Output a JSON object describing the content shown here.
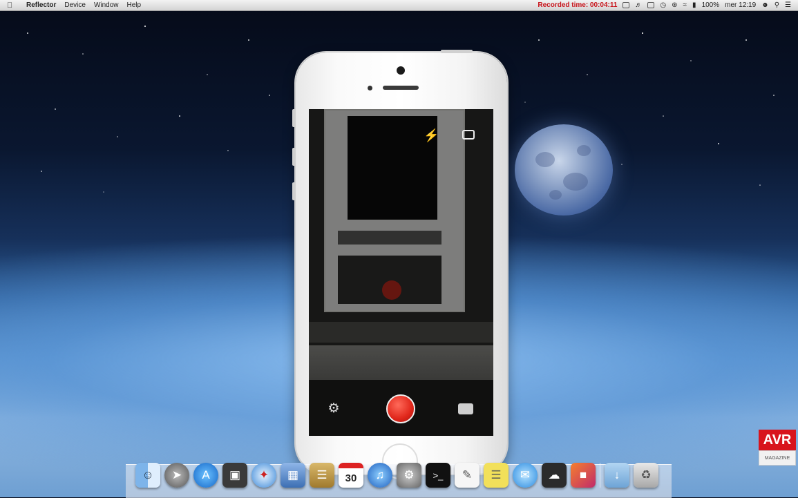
{
  "menubar": {
    "apple_icon": "apple-icon",
    "app_name": "Reflector",
    "menus": [
      "Device",
      "Window",
      "Help"
    ],
    "recording_label": "Recorded time: 00:04:11",
    "battery": "100%",
    "clock": "mer 12:19",
    "status_color": "#c8131a"
  },
  "phone": {
    "model": "iPhone",
    "camera_controls": {
      "flash_icon": "flash-auto-icon",
      "flip_icon": "camera-switch-icon",
      "settings_icon": "gear-icon",
      "shutter_icon": "record-button-icon",
      "mode_icon": "camera-roll-icon"
    }
  },
  "dock": {
    "items": [
      "finder",
      "launchpad",
      "app-store",
      "photo-booth",
      "safari",
      "preview",
      "notes-book",
      "calendar",
      "itunes",
      "system-preferences",
      "terminal",
      "textedit",
      "stickies",
      "messages",
      "icloud",
      "photos",
      "downloads-folder",
      "trash"
    ],
    "calendar_day": "30"
  },
  "watermark": {
    "brand": "AVR",
    "sub": "MAGAZINE"
  }
}
